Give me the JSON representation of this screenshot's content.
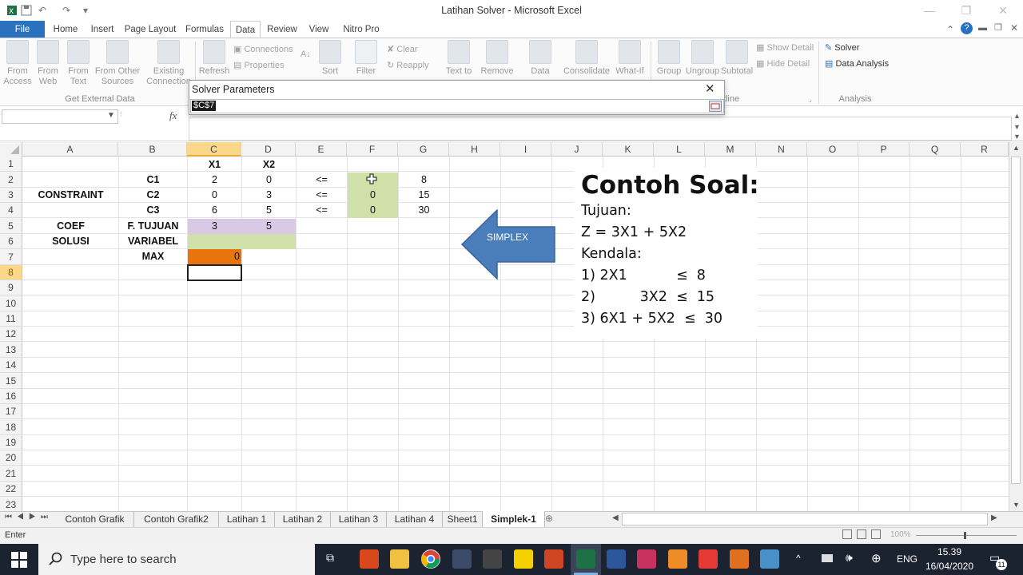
{
  "window": {
    "title": "Latihan Solver - Microsoft Excel"
  },
  "ribbon": {
    "tabs": [
      "File",
      "Home",
      "Insert",
      "Page Layout",
      "Formulas",
      "Data",
      "Review",
      "View",
      "Nitro Pro"
    ],
    "active_tab": "Data",
    "buttons": {
      "from_access": "From Access",
      "from_web": "From Web",
      "from_text": "From Text",
      "from_other": "From Other Sources",
      "existing": "Existing Connection",
      "refresh": "Refresh",
      "connections": "Connections",
      "properties": "Properties",
      "sort": "Sort",
      "filter": "Filter",
      "clear": "Clear",
      "reapply": "Reapply",
      "text_to": "Text to",
      "remove": "Remove",
      "data": "Data",
      "consolidate": "Consolidate",
      "what_if": "What-If",
      "group": "Group",
      "ungroup": "Ungroup",
      "subtotal": "Subtotal",
      "show_detail": "Show Detail",
      "hide_detail": "Hide Detail",
      "solver": "Solver",
      "data_analysis": "Data Analysis"
    },
    "groups": {
      "get_external": "Get External Data",
      "outline_partial": "tline",
      "analysis": "Analysis"
    }
  },
  "dialog": {
    "title": "Solver Parameters",
    "input_value": "$C$7"
  },
  "formula_bar": {
    "fx": "fx"
  },
  "columns": [
    "A",
    "B",
    "C",
    "D",
    "E",
    "F",
    "G",
    "H",
    "I",
    "J",
    "K",
    "L",
    "M",
    "N",
    "O",
    "P",
    "Q",
    "R"
  ],
  "rows": [
    "1",
    "2",
    "3",
    "4",
    "5",
    "6",
    "7",
    "8",
    "9",
    "10",
    "11",
    "12",
    "13",
    "14",
    "15",
    "16",
    "17",
    "18",
    "19",
    "20",
    "21",
    "22",
    "23"
  ],
  "cells": {
    "C1": "X1",
    "D1": "X2",
    "B2": "C1",
    "C2": "2",
    "D2": "0",
    "E2": "<=",
    "G2": "8",
    "A3": "CONSTRAINT",
    "B3": "C2",
    "C3": "0",
    "D3": "3",
    "E3": "<=",
    "F3": "0",
    "G3": "15",
    "B4": "C3",
    "C4": "6",
    "D4": "5",
    "E4": "<=",
    "F4": "0",
    "G4": "30",
    "A5": "COEF",
    "B5": "F. TUJUAN",
    "C5": "3",
    "D5": "5",
    "A6": "SOLUSI",
    "B6": "VARIABEL",
    "B7": "MAX",
    "C7": "0"
  },
  "arrow_label": "SIMPLEX",
  "textbox": {
    "title": "Contoh Soal:",
    "l1": "Tujuan:",
    "l2": "Z = 3X1 + 5X2",
    "l3": "Kendala:",
    "l4": "1) 2X1           ≤  8",
    "l5": "2)          3X2  ≤  15",
    "l6": "3) 6X1 + 5X2  ≤  30"
  },
  "sheets": [
    "Contoh Grafik",
    "Contoh Grafik2",
    "Latihan 1",
    "Latihan 2",
    "Latihan 3",
    "Latihan 4",
    "Sheet1",
    "Simplek-1"
  ],
  "active_sheet": "Simplek-1",
  "status": {
    "mode": "Enter",
    "zoom": "100%"
  },
  "taskbar": {
    "search_placeholder": "Type here to search",
    "lang": "ENG",
    "time": "15.39",
    "date": "16/04/2020",
    "notif": "11"
  },
  "colors": {
    "file_tab": "#2a72bd",
    "purple": "#d9c9e6",
    "green": "#cfe0a8",
    "orange": "#e8740e",
    "arrow": "#4a7ebb",
    "taskbar": "#1b2230"
  }
}
